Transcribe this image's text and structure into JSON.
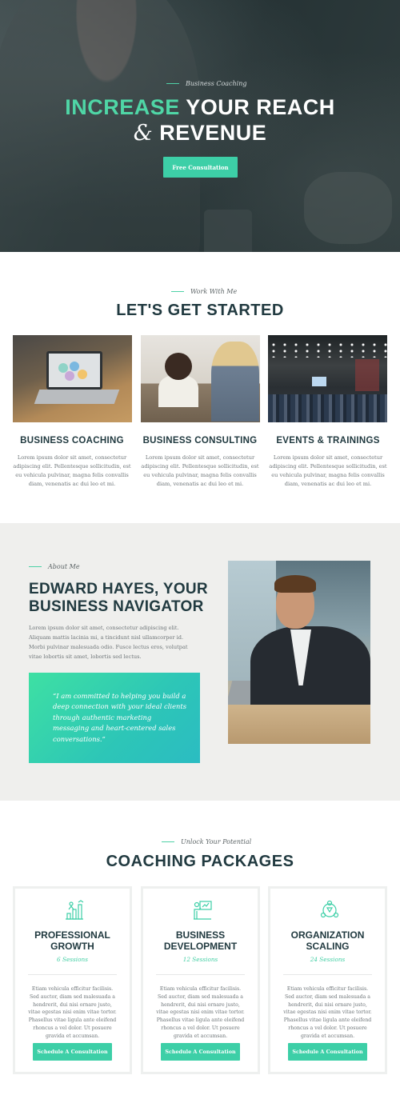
{
  "hero": {
    "eyebrow": "Business Coaching",
    "title_accent": "INCREASE",
    "title_rest": " YOUR REACH",
    "title_amp": "&",
    "title_line2": " REVENUE",
    "cta": "Free Consultation"
  },
  "started": {
    "eyebrow": "Work With Me",
    "title": "LET'S GET STARTED",
    "services": [
      {
        "title": "BUSINESS COACHING",
        "text": "Lorem ipsum dolor sit amet, consectetur adipiscing elit. Pellentesque sollicitudin, est eu vehicula pulvinar, magna felis convallis diam, venenatis ac dui leo et mi."
      },
      {
        "title": "BUSINESS CONSULTING",
        "text": "Lorem ipsum dolor sit amet, consectetur adipiscing elit. Pellentesque sollicitudin, est eu vehicula pulvinar, magna felis convallis diam, venenatis ac dui leo et mi."
      },
      {
        "title": "EVENTS & TRAININGS",
        "text": "Lorem ipsum dolor sit amet, consectetur adipiscing elit. Pellentesque sollicitudin, est eu vehicula pulvinar, magna felis convallis diam, venenatis ac dui leo et mi."
      }
    ]
  },
  "about": {
    "eyebrow": "About Me",
    "title": "EDWARD HAYES, YOUR BUSINESS NAVIGATOR",
    "text": "Lorem ipsum dolor sit amet, consectetur adipiscing elit. Aliquam mattis lacinia mi, a tincidunt nisl ullamcorper id. Morbi pulvinar malesuada odio. Fusce lectus eros, volutpat vitae lobortis sit amet, lobortis sed lectus.",
    "quote": "“I am committed to helping you build a deep connection with your ideal clients through authentic marketing messaging and heart-centered sales conversations.”"
  },
  "packages": {
    "eyebrow": "Unlock Your Potential",
    "title": "COACHING PACKAGES",
    "items": [
      {
        "title": "PROFESSIONAL GROWTH",
        "sessions": "6 Sessions",
        "icon": "growth-icon",
        "text": "Etiam vehicula efficitur facilisis. Sed auctor, diam sed malesuada a hendrerit, dui nisi ornare justo, vitae egestas nisi enim vitae tortor. Phasellus vitae ligula ante eleifend rhoncus a vel dolor. Ut posuere gravida et accumsan.",
        "cta": "Schedule A Consultation"
      },
      {
        "title": "BUSINESS DEVELOPMENT",
        "sessions": "12 Sessions",
        "icon": "presentation-icon",
        "text": "Etiam vehicula efficitur facilisis. Sed auctor, diam sed malesuada a hendrerit, dui nisi ornare justo, vitae egestas nisi enim vitae tortor. Phasellus vitae ligula ante eleifend rhoncus a vel dolor. Ut posuere gravida et accumsan.",
        "cta": "Schedule A Consultation"
      },
      {
        "title": "ORGANIZATION SCALING",
        "sessions": "24 Sessions",
        "icon": "team-icon",
        "text": "Etiam vehicula efficitur facilisis. Sed auctor, diam sed malesuada a hendrerit, dui nisi ornare justo, vitae egestas nisi enim vitae tortor. Phasellus vitae ligula ante eleifend rhoncus a vel dolor. Ut posuere gravida et accumsan.",
        "cta": "Schedule A Consultation"
      }
    ]
  },
  "colors": {
    "accent": "#3dcfa7",
    "heading": "#213a40",
    "hero_bg": "#2c3a3c",
    "about_bg": "#efefed"
  }
}
